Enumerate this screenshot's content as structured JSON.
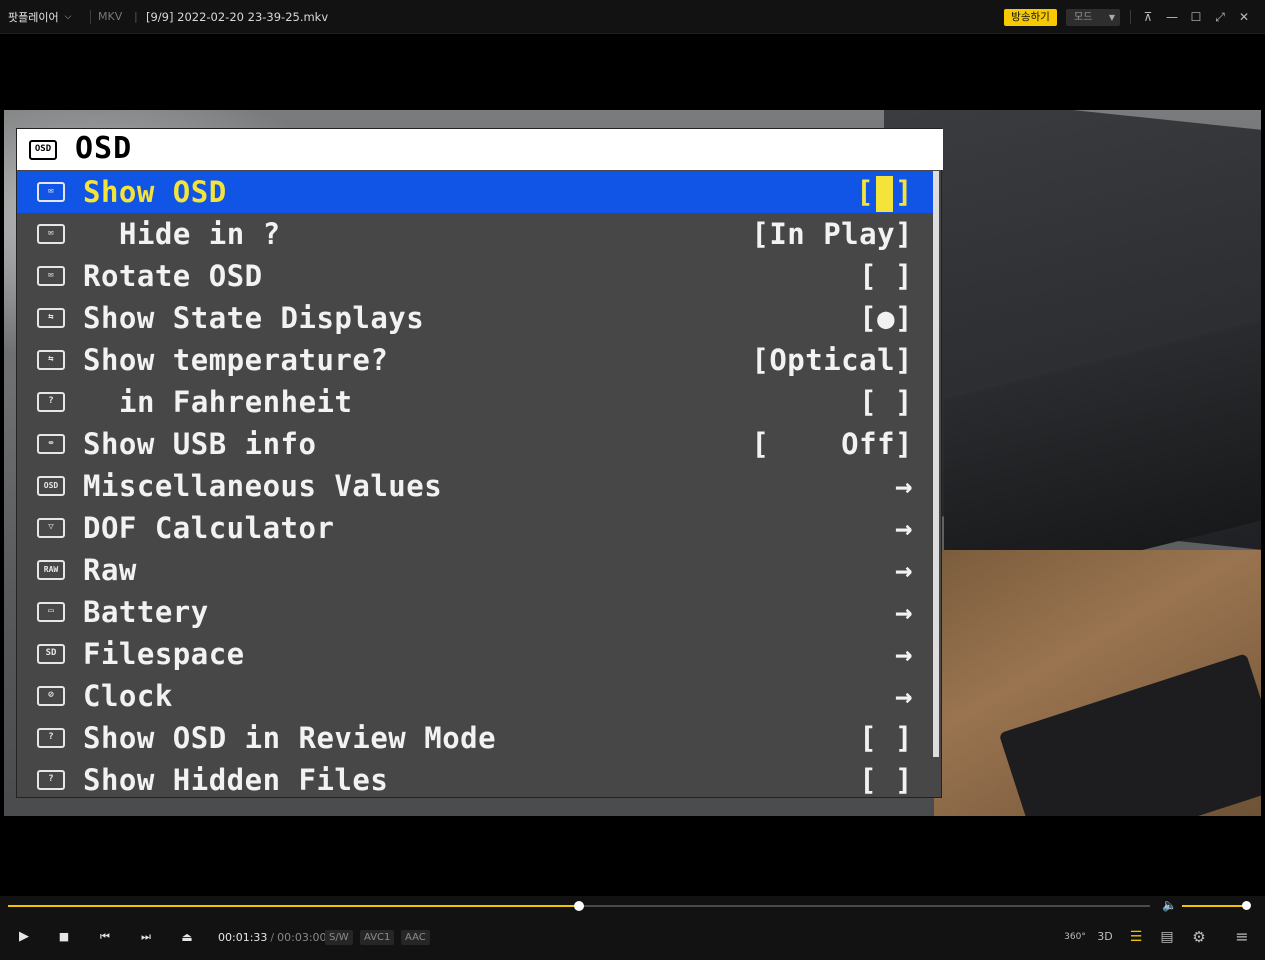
{
  "titlebar": {
    "app_name": "팟플레이어",
    "chevron": "⌵",
    "format": "MKV",
    "format_sep": "|",
    "filename": "[9/9] 2022-02-20 23-39-25.mkv",
    "broadcast_label": "방송하기",
    "mode_label": "모드",
    "mode_arrow": "▼",
    "pin": "⊼",
    "minimize": "—",
    "maximize": "☐",
    "fullscreen": "⤢",
    "close": "✕"
  },
  "osd": {
    "header_icon": "OSD",
    "title": "OSD",
    "rows": [
      {
        "icon": "✉",
        "label": "Show OSD",
        "value_left": "[",
        "value_right": "]",
        "indent": false,
        "selected": true
      },
      {
        "icon": "✉",
        "label": "Hide in ?",
        "value": "[In Play]",
        "indent": true
      },
      {
        "icon": "✉",
        "label": "Rotate OSD",
        "value": "[ ]"
      },
      {
        "icon": "⇆",
        "label": "Show State Displays",
        "value": "[●]"
      },
      {
        "icon": "⇆",
        "label": "Show temperature?",
        "value": "[Optical]"
      },
      {
        "icon": "?",
        "label": "in Fahrenheit",
        "value": "[ ]",
        "indent": true
      },
      {
        "icon": "⇎",
        "label": "Show USB info",
        "value": "[    Off]"
      },
      {
        "icon": "OSD",
        "label": "Miscellaneous Values",
        "value": "→"
      },
      {
        "icon": "▽",
        "label": "DOF Calculator",
        "value": "→"
      },
      {
        "icon": "RAW",
        "label": "Raw",
        "value": "→"
      },
      {
        "icon": "▭",
        "label": "Battery",
        "value": "→"
      },
      {
        "icon": "SD",
        "label": "Filespace",
        "value": "→"
      },
      {
        "icon": "⊘",
        "label": "Clock",
        "value": "→"
      },
      {
        "icon": "?",
        "label": "Show OSD in Review Mode",
        "value": "[ ]"
      },
      {
        "icon": "?",
        "label": "Show Hidden Files",
        "value": "[ ]"
      }
    ]
  },
  "controls": {
    "seek_progress": 0.5,
    "volume": 1.0,
    "current_time": "00:01:33",
    "total_time": "00:03:00",
    "time_sep": "/",
    "tags": [
      "S/W",
      "AVC1",
      "AAC"
    ],
    "play": "▶",
    "stop": "■",
    "prev": "⏮",
    "next": "⏭",
    "eject": "⏏",
    "btn_360": "360°",
    "btn_3d": "3D",
    "playlist_search": "☰",
    "list": "▤",
    "settings": "⚙",
    "menu": "≡",
    "volume_icon": "🔈"
  },
  "colors": {
    "accent": "#f3c300",
    "osd_bg": "#474747",
    "osd_select": "#1155e6",
    "osd_select_text": "#f4e33a"
  }
}
